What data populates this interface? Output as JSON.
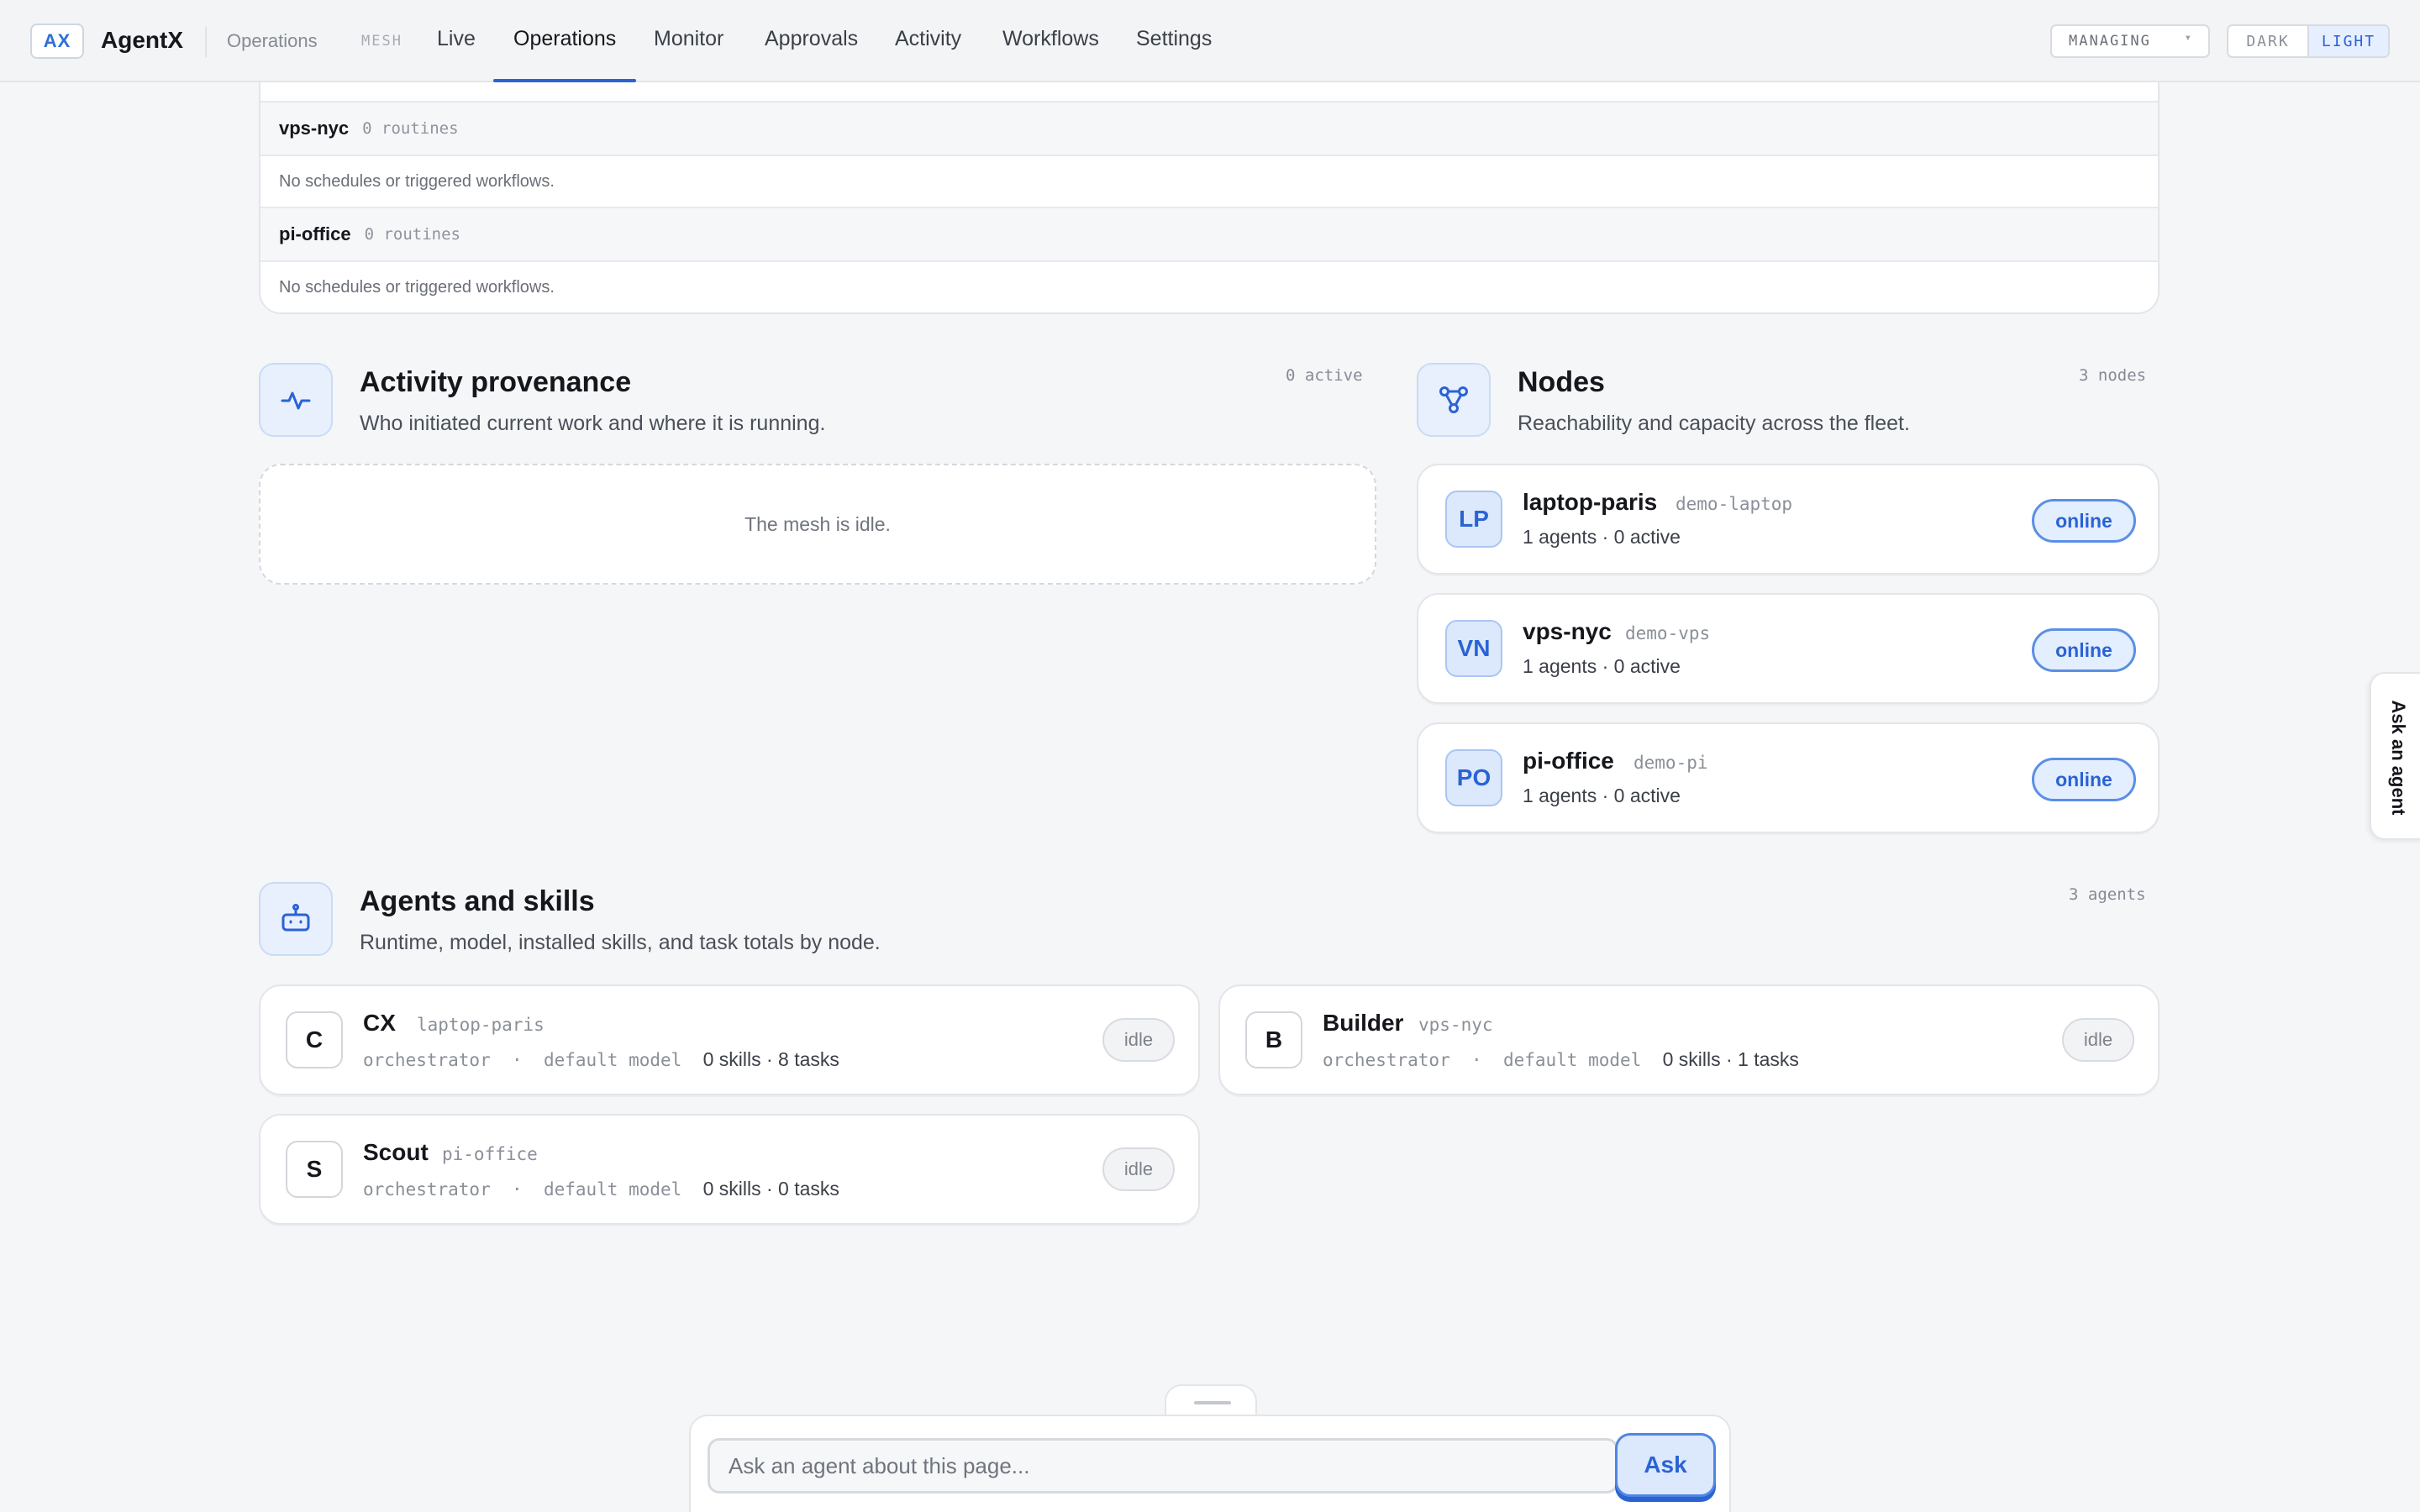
{
  "app": {
    "logo": "AX",
    "name": "AgentX",
    "breadcrumb": "Operations",
    "mesh_label": "MESH"
  },
  "nav": {
    "tabs": [
      {
        "label": "Live",
        "active": false
      },
      {
        "label": "Operations",
        "active": true
      },
      {
        "label": "Monitor",
        "active": false
      },
      {
        "label": "Approvals",
        "active": false
      },
      {
        "label": "Activity",
        "active": false
      },
      {
        "label": "Workflows",
        "active": false
      },
      {
        "label": "Settings",
        "active": false
      }
    ]
  },
  "controls": {
    "managing_label": "MANAGING",
    "theme_dark": "DARK",
    "theme_light": "LIGHT",
    "theme_selected": "LIGHT"
  },
  "routines": [
    {
      "node": "vps-nyc",
      "count": "0 routines",
      "empty_text": "No schedules or triggered workflows."
    },
    {
      "node": "pi-office",
      "count": "0 routines",
      "empty_text": "No schedules or triggered workflows."
    }
  ],
  "activity": {
    "title": "Activity provenance",
    "subtitle": "Who initiated current work and where it is running.",
    "count": "0 active",
    "empty_text": "The mesh is idle.",
    "icon": "activity-pulse-icon"
  },
  "nodes": {
    "title": "Nodes",
    "subtitle": "Reachability and capacity across the fleet.",
    "count": "3 nodes",
    "icon": "network-nodes-icon",
    "items": [
      {
        "initials": "LP",
        "name": "laptop-paris",
        "host": "demo-laptop",
        "meta": "1 agents · 0 active",
        "status": "online"
      },
      {
        "initials": "VN",
        "name": "vps-nyc",
        "host": "demo-vps",
        "meta": "1 agents · 0 active",
        "status": "online"
      },
      {
        "initials": "PO",
        "name": "pi-office",
        "host": "demo-pi",
        "meta": "1 agents · 0 active",
        "status": "online"
      }
    ]
  },
  "agents": {
    "title": "Agents and skills",
    "subtitle": "Runtime, model, installed skills, and task totals by node.",
    "count": "3 agents",
    "icon": "robot-icon",
    "items": [
      {
        "initial": "C",
        "name": "CX",
        "node": "laptop-paris",
        "runtime": "orchestrator",
        "model": "default model",
        "totals": "0 skills · 8 tasks",
        "status": "idle"
      },
      {
        "initial": "B",
        "name": "Builder",
        "node": "vps-nyc",
        "runtime": "orchestrator",
        "model": "default model",
        "totals": "0 skills · 1 tasks",
        "status": "idle"
      },
      {
        "initial": "S",
        "name": "Scout",
        "node": "pi-office",
        "runtime": "orchestrator",
        "model": "default model",
        "totals": "0 skills · 0 tasks",
        "status": "idle"
      }
    ]
  },
  "side_tab": {
    "label": "Ask an agent"
  },
  "ask": {
    "placeholder": "Ask an agent about this page...",
    "button": "Ask"
  },
  "colors": {
    "accent": "#2a63d4",
    "accent_soft": "#e3eefe",
    "background": "#f5f6f8"
  }
}
